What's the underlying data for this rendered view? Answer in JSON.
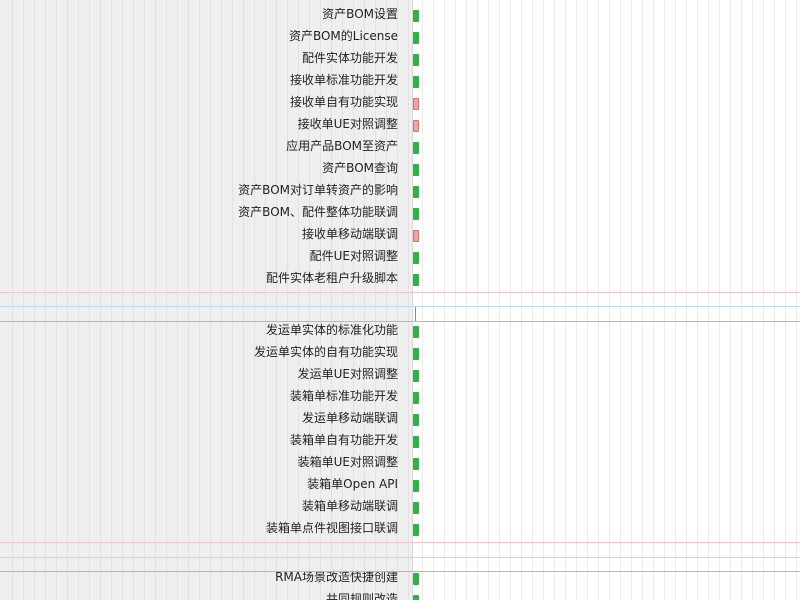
{
  "colors": {
    "bar_complete": "#2fb344",
    "bar_overdue": "#f2a3a3",
    "separator_red": "#f1c4c8",
    "separator_blue": "#c4d6ea",
    "left_panel": "#efefef"
  },
  "groups": [
    {
      "tasks": [
        {
          "label": "资产BOM设置",
          "status": "green"
        },
        {
          "label": "资产BOM的License",
          "status": "green"
        },
        {
          "label": "配件实体功能开发",
          "status": "green"
        },
        {
          "label": "接收单标准功能开发",
          "status": "green"
        },
        {
          "label": "接收单自有功能实现",
          "status": "red"
        },
        {
          "label": "接收单UE对照调整",
          "status": "red"
        },
        {
          "label": "应用产品BOM至资产",
          "status": "green"
        },
        {
          "label": "资产BOM查询",
          "status": "green"
        },
        {
          "label": "资产BOM对订单转资产的影响",
          "status": "green"
        },
        {
          "label": "资产BOM、配件整体功能联调",
          "status": "green"
        },
        {
          "label": "接收单移动端联调",
          "status": "red"
        },
        {
          "label": "配件UE对照调整",
          "status": "green"
        },
        {
          "label": "配件实体老租户升级脚本",
          "status": "green"
        }
      ]
    },
    {
      "tasks": [
        {
          "label": "发运单实体的标准化功能",
          "status": "green"
        },
        {
          "label": "发运单实体的自有功能实现",
          "status": "green"
        },
        {
          "label": "发运单UE对照调整",
          "status": "green"
        },
        {
          "label": "装箱单标准功能开发",
          "status": "green"
        },
        {
          "label": "发运单移动端联调",
          "status": "green"
        },
        {
          "label": "装箱单自有功能开发",
          "status": "green"
        },
        {
          "label": "装箱单UE对照调整",
          "status": "green"
        },
        {
          "label": "装箱单Open API",
          "status": "green"
        },
        {
          "label": "装箱单移动端联调",
          "status": "green"
        },
        {
          "label": "装箱单点件视图接口联调",
          "status": "green"
        }
      ]
    },
    {
      "tasks": [
        {
          "label": "RMA场景改造快捷创建",
          "status": "green"
        },
        {
          "label": "共同规则改造",
          "status": "green"
        }
      ]
    }
  ]
}
